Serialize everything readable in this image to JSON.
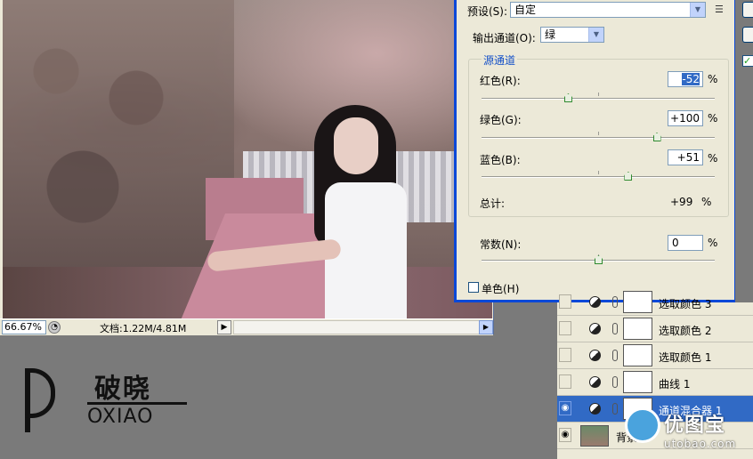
{
  "document": {
    "zoom": "66.67%",
    "doc_size": "文档:1.22M/4.81M",
    "status_arrow": "▶"
  },
  "logo": {
    "chinese": "破晓",
    "english": "OXIAO"
  },
  "channel_mixer": {
    "preset_label": "预设(S):",
    "preset_value": "自定",
    "output_channel_label": "输出通道(O):",
    "output_channel_value": "绿",
    "source_group_title": "源通道",
    "red_label": "红色(R):",
    "red_value": "-52",
    "green_label": "绿色(G):",
    "green_value": "+100",
    "blue_label": "蓝色(B):",
    "blue_value": "+51",
    "total_label": "总计:",
    "total_value": "+99",
    "constant_label": "常数(N):",
    "constant_value": "0",
    "monochrome_label": "单色(H)",
    "percent": "%",
    "slider_levels": {
      "red": -52,
      "green": 100,
      "blue": 51,
      "constant": 0
    }
  },
  "layers": [
    {
      "name": "选取颜色 3",
      "visible": false,
      "active": false,
      "type": "adjustment"
    },
    {
      "name": "选取颜色 2",
      "visible": false,
      "active": false,
      "type": "adjustment"
    },
    {
      "name": "选取颜色 1",
      "visible": false,
      "active": false,
      "type": "adjustment"
    },
    {
      "name": "曲线 1",
      "visible": false,
      "active": false,
      "type": "adjustment"
    },
    {
      "name": "通道混合器 1",
      "visible": true,
      "active": true,
      "type": "adjustment"
    },
    {
      "name": "背景",
      "visible": true,
      "active": false,
      "type": "image"
    }
  ],
  "watermark": {
    "title": "优图宝",
    "url": "utobao.com"
  },
  "colors": {
    "dialog_bg": "#ece9d8",
    "selection_blue": "#316ac5",
    "xp_border_blue": "#0a48d8",
    "group_title_blue": "#1450c8"
  }
}
